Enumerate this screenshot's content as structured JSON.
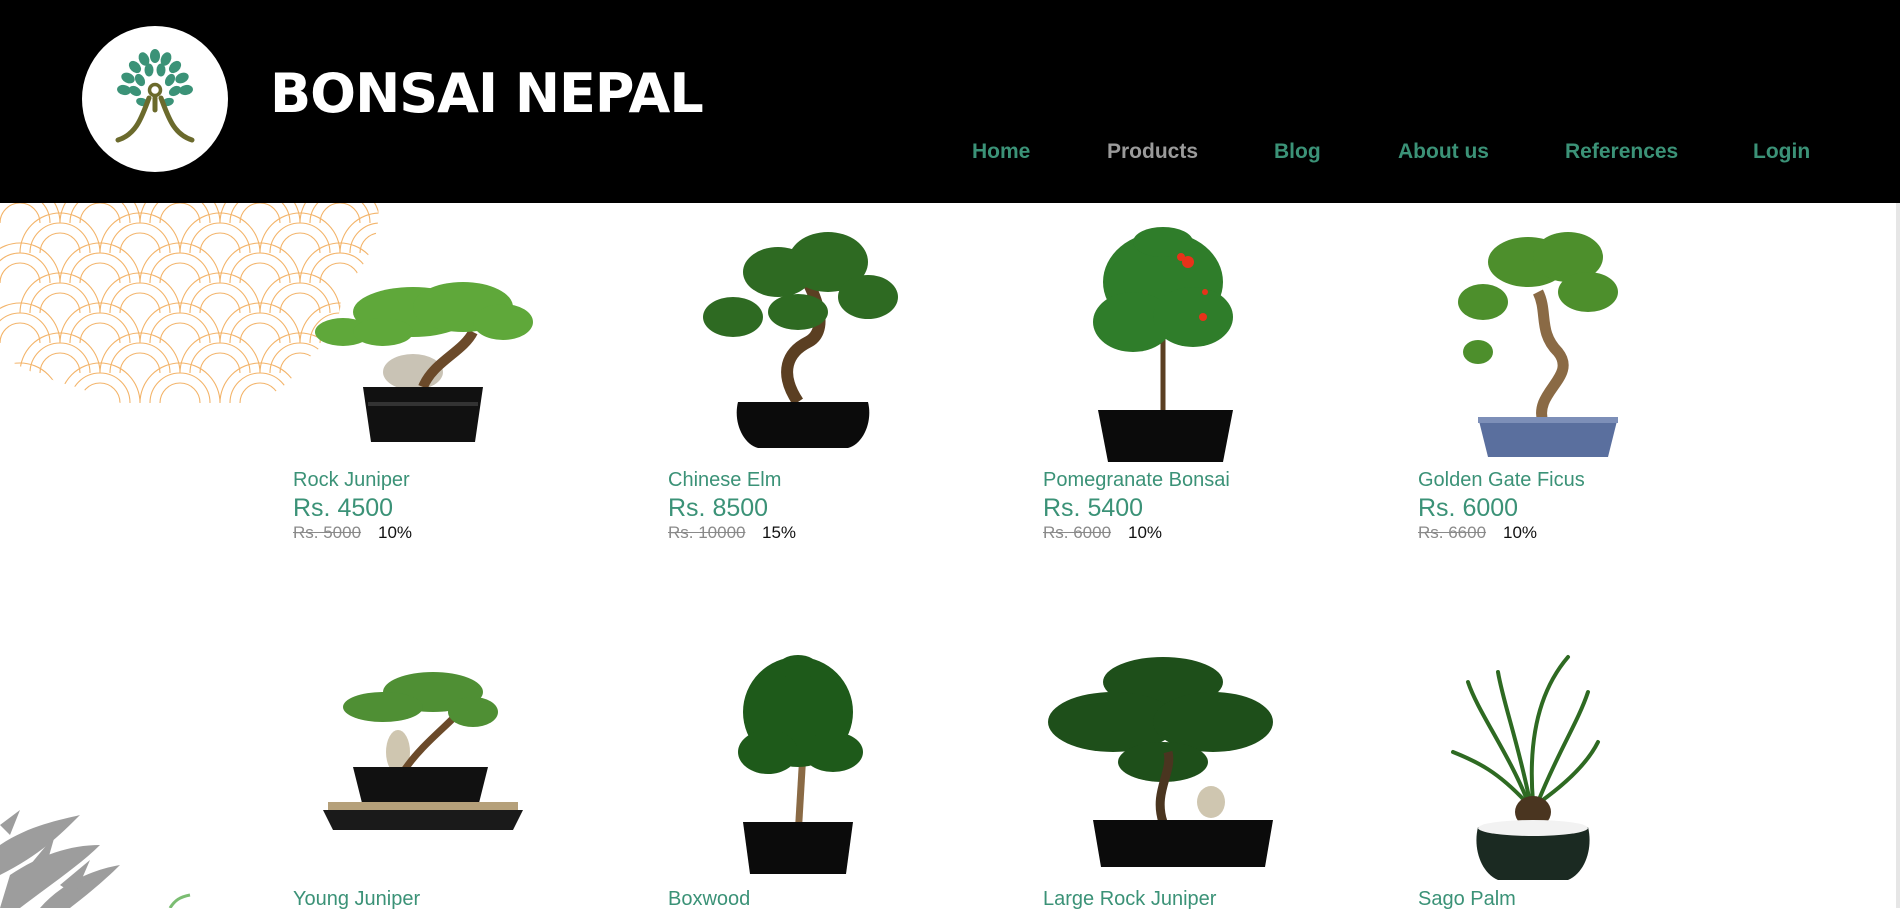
{
  "brand": {
    "name": "BONSAI NEPAL",
    "accent": "#3b9277",
    "logo_icon": "tree-person-logo-icon"
  },
  "nav": {
    "items": [
      {
        "label": "Home",
        "active": true
      },
      {
        "label": "Products",
        "active": false
      },
      {
        "label": "Blog",
        "active": true
      },
      {
        "label": "About us",
        "active": true
      },
      {
        "label": "References",
        "active": true
      },
      {
        "label": "Login",
        "active": true
      }
    ]
  },
  "products": [
    {
      "name": "Rock Juniper",
      "price": "Rs. 4500",
      "old_price": "Rs. 5000",
      "discount": "10%",
      "icon": "juniper-bonsai-icon"
    },
    {
      "name": "Chinese Elm",
      "price": "Rs. 8500",
      "old_price": "Rs. 10000",
      "discount": "15%",
      "icon": "elm-bonsai-icon"
    },
    {
      "name": "Pomegranate Bonsai",
      "price": "Rs. 5400",
      "old_price": "Rs. 6000",
      "discount": "10%",
      "icon": "pomegranate-bonsai-icon"
    },
    {
      "name": "Golden Gate Ficus",
      "price": "Rs. 6000",
      "old_price": "Rs. 6600",
      "discount": "10%",
      "icon": "ficus-bonsai-icon"
    },
    {
      "name": "Young Juniper",
      "icon": "young-juniper-bonsai-icon"
    },
    {
      "name": "Boxwood",
      "icon": "boxwood-bonsai-icon"
    },
    {
      "name": "Large Rock Juniper",
      "icon": "large-juniper-bonsai-icon"
    },
    {
      "name": "Sago Palm",
      "icon": "sago-palm-bonsai-icon"
    }
  ]
}
